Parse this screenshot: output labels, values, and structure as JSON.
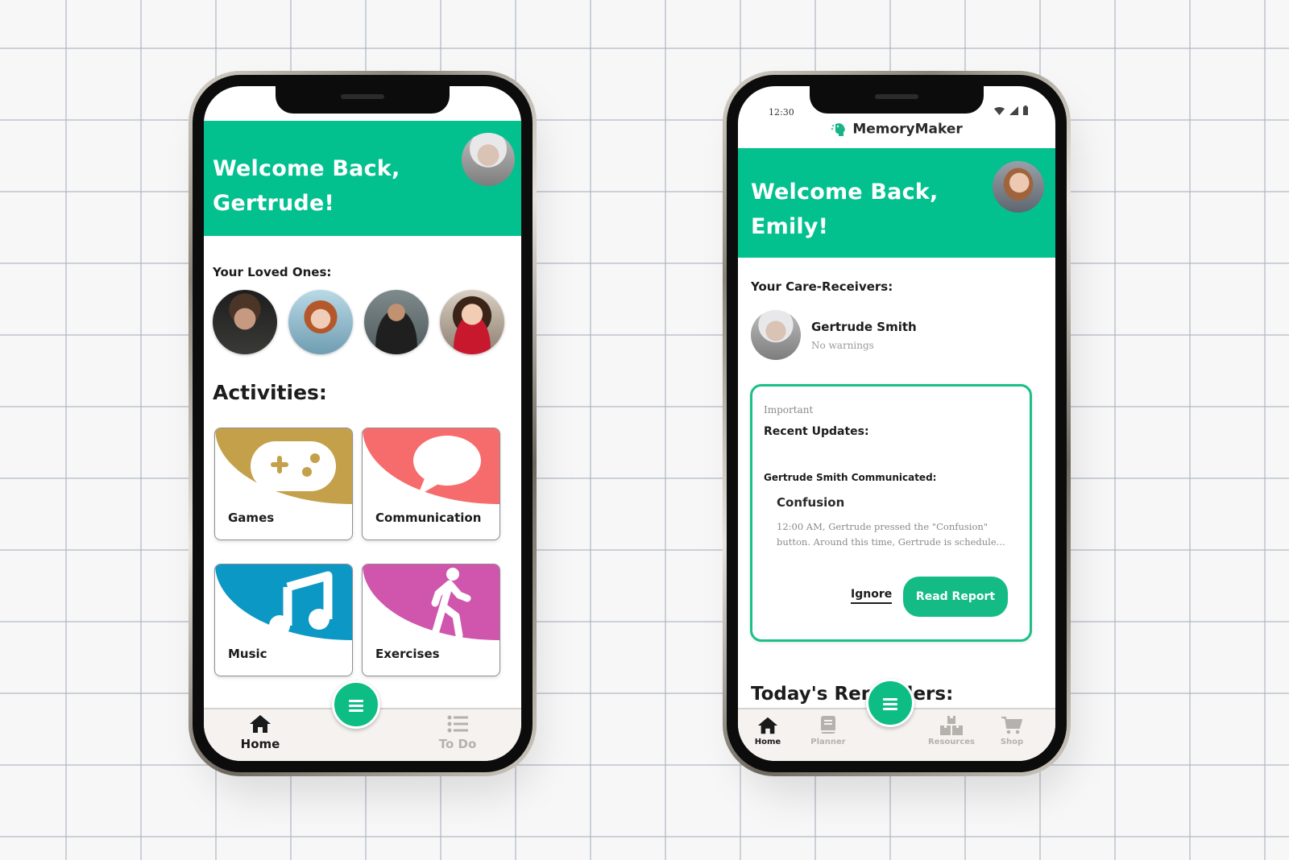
{
  "brand_color": "#03c08f",
  "left_phone": {
    "hero": {
      "greeting_line1": "Welcome Back,",
      "greeting_line2": "Gertrude!",
      "avatar": "elderly-woman-avatar"
    },
    "loved_ones": {
      "label": "Your Loved Ones:",
      "people": [
        {
          "avatar": "young-man-avatar"
        },
        {
          "avatar": "red-haired-woman-avatar"
        },
        {
          "avatar": "bearded-man-avatar"
        },
        {
          "avatar": "smiling-woman-avatar"
        }
      ]
    },
    "activities": {
      "label": "Activities:",
      "items": [
        {
          "label": "Games",
          "icon": "gamepad-icon",
          "color": "#c4a04a"
        },
        {
          "label": "Communication",
          "icon": "speech-bubble-icon",
          "color": "#f66b6b"
        },
        {
          "label": "Music",
          "icon": "music-note-icon",
          "color": "#0c98c4"
        },
        {
          "label": "Exercises",
          "icon": "walking-person-icon",
          "color": "#cf55ad"
        }
      ]
    },
    "tabbar": {
      "tabs": [
        {
          "label": "Home",
          "icon": "home-icon",
          "active": true
        },
        {
          "label": "To Do",
          "icon": "list-icon",
          "active": false
        }
      ],
      "fab_icon": "menu-icon"
    }
  },
  "right_phone": {
    "status_bar": {
      "time": "12:30",
      "icons": [
        "wifi-icon",
        "signal-icon",
        "battery-icon"
      ]
    },
    "app_header": {
      "logo_icon": "brain-head-icon",
      "title": "MemoryMaker"
    },
    "hero": {
      "greeting_line1": "Welcome Back,",
      "greeting_line2": "Emily!",
      "avatar": "emily-avatar"
    },
    "care_receivers": {
      "label": "Your Care-Receivers:",
      "items": [
        {
          "name": "Gertrude Smith",
          "status": "No warnings",
          "avatar": "elderly-woman-avatar"
        }
      ]
    },
    "updates_card": {
      "tag": "Important",
      "title": "Recent Updates:",
      "source": "Gertrude Smith Communicated:",
      "event_title": "Confusion",
      "event_body": "12:00 AM, Gertrude pressed the \"Confusion\" button. Around this time, Gertrude is schedule...",
      "ignore_label": "Ignore",
      "read_report_label": "Read Report"
    },
    "reminders": {
      "label": "Today's Reminders:"
    },
    "tabbar": {
      "tabs": [
        {
          "label": "Home",
          "icon": "home-icon",
          "active": true
        },
        {
          "label": "Planner",
          "icon": "planner-book-icon",
          "active": false
        },
        {
          "label": "Resources",
          "icon": "boxes-icon",
          "active": false
        },
        {
          "label": "Shop",
          "icon": "cart-icon",
          "active": false
        }
      ],
      "fab_icon": "menu-icon"
    }
  }
}
